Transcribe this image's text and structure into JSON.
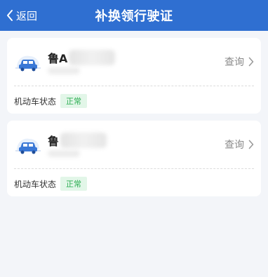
{
  "header": {
    "back_label": "返回",
    "title": "补换领行驶证",
    "background": "#2f6fd1"
  },
  "vehicles": [
    {
      "plate_prefix": "鲁A",
      "query_label": "查询",
      "status_label": "机动车状态",
      "status_value": "正常"
    },
    {
      "plate_prefix": "鲁",
      "query_label": "查询",
      "status_label": "机动车状态",
      "status_value": "正常"
    }
  ],
  "icons": {
    "back": "chevron-left-icon",
    "vehicle": "car-icon",
    "query": "chevron-right-icon"
  },
  "colors": {
    "accent": "#2f6fd1",
    "status_green": "#2cae52",
    "status_bg": "#e2f6e8"
  }
}
